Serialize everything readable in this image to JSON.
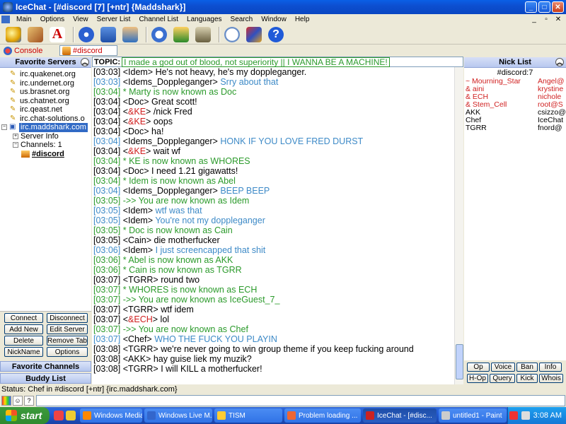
{
  "window": {
    "title": "IceChat - [#discord [7] [+ntr] {Maddshark}]"
  },
  "menu": [
    "Main",
    "Options",
    "View",
    "Server List",
    "Channel List",
    "Languages",
    "Search",
    "Window",
    "Help"
  ],
  "tabs": {
    "console": "Console",
    "channel": "#discord"
  },
  "left_panel": {
    "header": "Favorite Servers",
    "servers": [
      "irc.quakenet.org",
      "irc.undernet.org",
      "us.brasnet.org",
      "us.chatnet.org",
      "irc.qeast.net",
      "irc.chat-solutions.o"
    ],
    "connected_server": "irc.maddshark.com",
    "server_info": "Server Info",
    "channels_label": "Channels: 1",
    "channel": "#discord",
    "buttons": {
      "connect": "Connect",
      "disconnect": "Disconnect",
      "add_new": "Add New",
      "edit_server": "Edit Server",
      "delete": "Delete",
      "remove_tab": "Remove Tab",
      "nickname": "NickName",
      "options": "Options"
    },
    "favorite_channels": "Favorite Channels",
    "buddy_list": "Buddy List"
  },
  "topic": {
    "label": "TOPIC:",
    "text": "I made a god out of blood, not superiority  ||  I WANNA BE A MACHINE!"
  },
  "colors": {
    "normal": "#000000",
    "join": "#2b9a2b",
    "self": "#3d8ac7",
    "op": "#d02020"
  },
  "chat_lines": [
    {
      "ts": "[03:03]",
      "prefix": "<Idem>",
      "text": " He's not heavy, he's my doppleganger.",
      "kind": "normal"
    },
    {
      "ts": "[03:03]",
      "prefix": "<Idems_Doppleganger>",
      "text": " Srry about that",
      "kind": "self"
    },
    {
      "ts": "[03:04]",
      "prefix": "*",
      "text": " Marty is now known as Doc",
      "kind": "join"
    },
    {
      "ts": "[03:04]",
      "prefix": "<Doc>",
      "text": " Great scott!",
      "kind": "normal"
    },
    {
      "ts": "[03:04]",
      "prefix": "<",
      "op": "&KE",
      "suffix": ">",
      "text": " /nick Fred",
      "kind": "opline"
    },
    {
      "ts": "[03:04]",
      "prefix": "<",
      "op": "&KE",
      "suffix": ">",
      "text": " oops",
      "kind": "opline"
    },
    {
      "ts": "[03:04]",
      "prefix": "<Doc>",
      "text": " ha!",
      "kind": "normal"
    },
    {
      "ts": "[03:04]",
      "prefix": "<Idems_Doppleganger>",
      "text": " HONK IF YOU LOVE FRED DURST",
      "kind": "self"
    },
    {
      "ts": "[03:04]",
      "prefix": "<",
      "op": "&KE",
      "suffix": ">",
      "text": " wait wf",
      "kind": "opline"
    },
    {
      "ts": "[03:04]",
      "prefix": "*",
      "text": " KE is now known as WHORES",
      "kind": "join"
    },
    {
      "ts": "[03:04]",
      "prefix": "<Doc>",
      "text": " I need 1.21 gigawatts!",
      "kind": "normal"
    },
    {
      "ts": "[03:04]",
      "prefix": "*",
      "text": " Idem is now known as Abel",
      "kind": "join"
    },
    {
      "ts": "[03:04]",
      "prefix": "<Idems_Doppleganger>",
      "text": " BEEP BEEP",
      "kind": "self"
    },
    {
      "ts": "[03:05]",
      "prefix": "->>",
      "text": " You are now known as Idem",
      "kind": "join"
    },
    {
      "ts": "[03:05]",
      "prefix": "<Idem>",
      "text": " wtf was that",
      "kind": "self"
    },
    {
      "ts": "[03:05]",
      "prefix": "<Idem>",
      "text": " You're not my doppleganger",
      "kind": "self"
    },
    {
      "ts": "[03:05]",
      "prefix": "*",
      "text": " Doc is now known as Cain",
      "kind": "join"
    },
    {
      "ts": "[03:05]",
      "prefix": "<Cain>",
      "text": " die motherfucker",
      "kind": "normal"
    },
    {
      "ts": "[03:06]",
      "prefix": "<Idem>",
      "text": " I just screencapped that shit",
      "kind": "self"
    },
    {
      "ts": "[03:06]",
      "prefix": "*",
      "text": " Abel is now known as AKK",
      "kind": "join"
    },
    {
      "ts": "[03:06]",
      "prefix": "*",
      "text": " Cain is now known as TGRR",
      "kind": "join"
    },
    {
      "ts": "[03:07]",
      "prefix": "<TGRR>",
      "text": " round two",
      "kind": "normal"
    },
    {
      "ts": "[03:07]",
      "prefix": "*",
      "text": " WHORES is now known as ECH",
      "kind": "join"
    },
    {
      "ts": "[03:07]",
      "prefix": "->>",
      "text": " You are now known as IceGuest_7_",
      "kind": "join"
    },
    {
      "ts": "[03:07]",
      "prefix": "<TGRR>",
      "text": " wtf idem",
      "kind": "normal"
    },
    {
      "ts": "[03:07]",
      "prefix": "<",
      "op": "&ECH",
      "suffix": ">",
      "text": " lol",
      "kind": "opline"
    },
    {
      "ts": "[03:07]",
      "prefix": "->>",
      "text": " You are now known as Chef",
      "kind": "join"
    },
    {
      "ts": "[03:07]",
      "prefix": "<Chef>",
      "text": " WHO THE FUCK YOU PLAYIN",
      "kind": "self"
    },
    {
      "ts": "[03:08]",
      "prefix": "<TGRR>",
      "text": " we're never going to win group theme if you keep fucking around",
      "kind": "normal",
      "wrap": true
    },
    {
      "ts": "[03:08]",
      "prefix": "<AKK>",
      "text": " hay guise liek my muzik?",
      "kind": "normal"
    },
    {
      "ts": "[03:08]",
      "prefix": "<TGRR>",
      "text": " I will KILL a motherfucker!",
      "kind": "normal"
    }
  ],
  "nick_panel": {
    "header": "Nick List",
    "channel": "#discord:7",
    "nicks": [
      {
        "nick": "~ Mourning_Star",
        "host": "Angel@",
        "op": true
      },
      {
        "nick": "& aini",
        "host": "krystine",
        "op": true
      },
      {
        "nick": "& ECH",
        "host": "nichole",
        "op": true
      },
      {
        "nick": "& Stem_Cell",
        "host": "root@S",
        "op": true
      },
      {
        "nick": "AKK",
        "host": "csizzo@",
        "op": false
      },
      {
        "nick": "Chef",
        "host": "IceChat",
        "op": false
      },
      {
        "nick": "TGRR",
        "host": "fnord@",
        "op": false
      }
    ],
    "buttons": {
      "op": "Op",
      "voice": "Voice",
      "ban": "Ban",
      "info": "Info",
      "hop": "H-Op",
      "query": "Query",
      "kick": "Kick",
      "whois": "Whois"
    }
  },
  "status": "Status: Chef in #discord [+ntr] {irc.maddshark.com}",
  "taskbar": {
    "start": "start",
    "tasks": [
      "Windows Media ...",
      "Windows Live M...",
      "TISM",
      "Problem loading ...",
      "IceChat - [#disc...",
      "untitled1 - Paint"
    ],
    "active_task": 4,
    "clock": "3:08 AM"
  }
}
